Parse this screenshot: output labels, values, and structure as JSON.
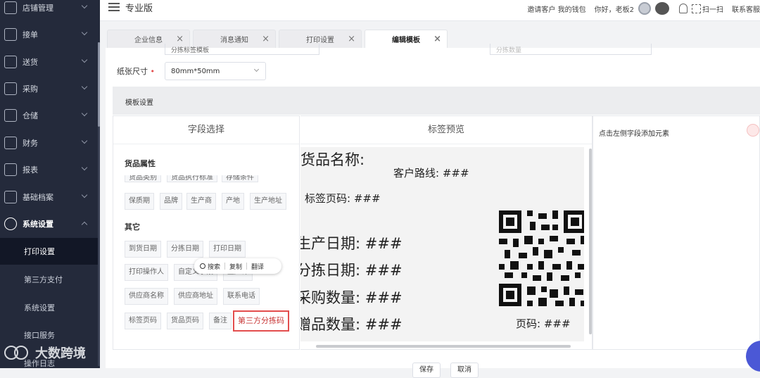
{
  "sidebar": {
    "items": [
      {
        "label": "店铺管理",
        "icon": "store-icon"
      },
      {
        "label": "接单",
        "icon": "order-icon"
      },
      {
        "label": "送货",
        "icon": "delivery-icon"
      },
      {
        "label": "采购",
        "icon": "purchase-icon"
      },
      {
        "label": "仓储",
        "icon": "warehouse-icon"
      },
      {
        "label": "财务",
        "icon": "finance-icon"
      },
      {
        "label": "报表",
        "icon": "report-icon"
      },
      {
        "label": "基础档案",
        "icon": "archive-icon"
      },
      {
        "label": "系统设置",
        "icon": "gear-icon"
      }
    ],
    "sub_items": [
      {
        "label": "打印设置",
        "selected": true
      },
      {
        "label": "第三方支付",
        "selected": false
      },
      {
        "label": "系统设置",
        "selected": false
      },
      {
        "label": "接口服务",
        "selected": false
      },
      {
        "label": "操作日志",
        "selected": false
      }
    ]
  },
  "watermark": "大数跨境",
  "topbar": {
    "version": "专业版",
    "links": "邀请客户 我的钱包",
    "greeting": "你好，老板2",
    "scan": "扫一扫",
    "contact": "联系客服"
  },
  "tabs": [
    {
      "label": "企业信息",
      "active": false
    },
    {
      "label": "消息通知",
      "active": false
    },
    {
      "label": "打印设置",
      "active": false
    },
    {
      "label": "编辑模板",
      "active": true
    }
  ],
  "form": {
    "name_value": "分拣标签模板",
    "count_placeholder": "分拣数量",
    "paper_size_label": "纸张尺寸",
    "paper_size_value": "80mm*50mm"
  },
  "template_settings_title": "模板设置",
  "field_panel": {
    "title": "字段选择",
    "groups": [
      {
        "title": "货品属性",
        "cut_chips": [
          "货品类别",
          "货品执行标准",
          "存储条件"
        ],
        "chips": [
          "保质期",
          "品牌",
          "生产商",
          "产地",
          "生产地址"
        ]
      },
      {
        "title": "其它",
        "chips": [
          "到货日期",
          "分拣日期",
          "打印日期",
          "打印操作人",
          "自定义字段",
          "生产许",
          "供应商名称",
          "供应商地址",
          "联系电话",
          "标签页码",
          "货品页码",
          "备注",
          "第三方分拣码"
        ]
      }
    ]
  },
  "context_popup": {
    "search": "搜索",
    "copy": "复制",
    "translate": "翻译"
  },
  "preview": {
    "title": "标签预览",
    "lines": {
      "goods_name": "货品名称:",
      "customer_route": "客户路线: ###",
      "label_page": "标签页码: ###",
      "production_date": "生产日期: ###",
      "sort_date": "分拣日期: ###",
      "purchase_qty": "采购数量: ###",
      "gift_qty": "赠品数量: ###",
      "page_no": "页码: ###"
    }
  },
  "right_panel": {
    "hint": "点击左侧字段添加元素"
  },
  "buttons": {
    "save": "保存",
    "cancel": "取消"
  }
}
